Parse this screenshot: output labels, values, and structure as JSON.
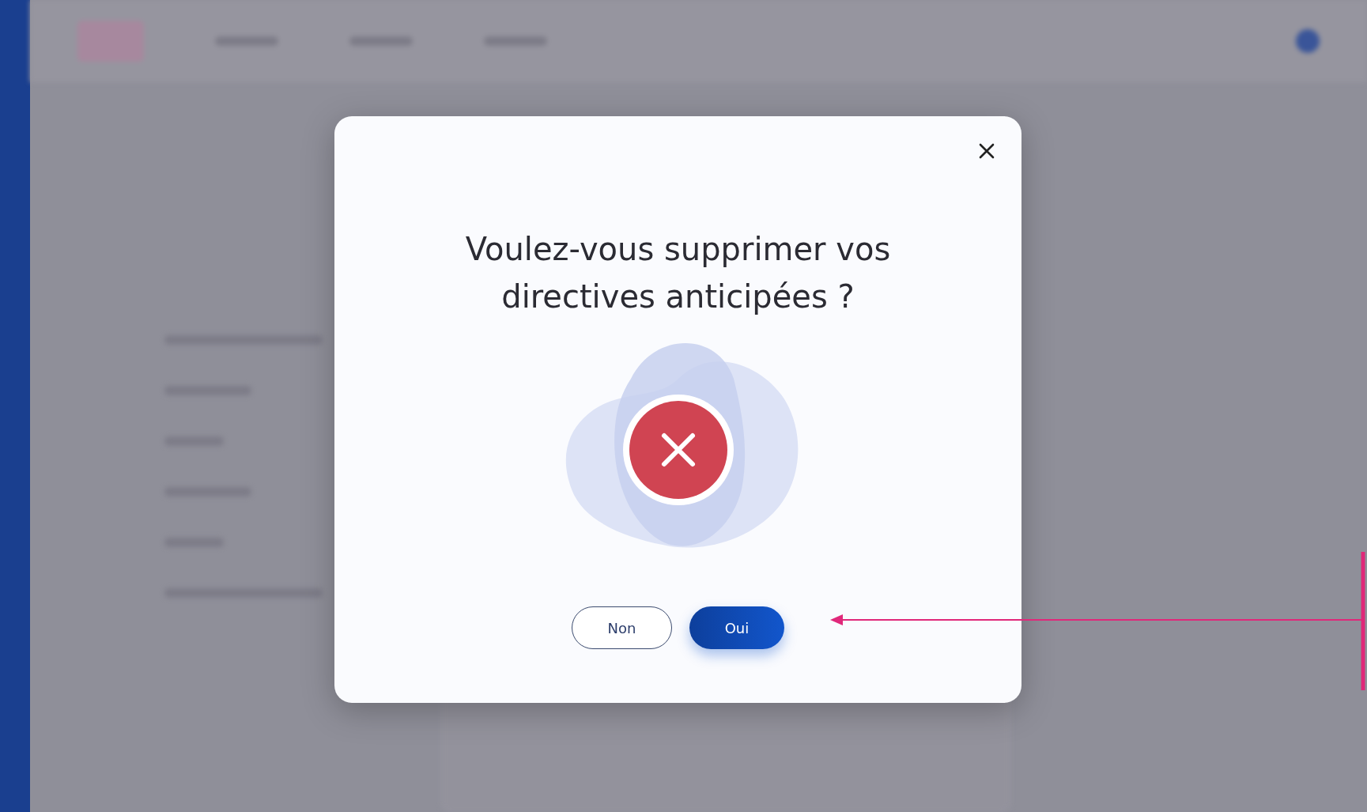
{
  "dialog": {
    "title": "Voulez-vous supprimer vos directives anticipées ?",
    "buttons": [
      {
        "label": "Non",
        "kind": "secondary"
      },
      {
        "label": "Oui",
        "kind": "primary"
      }
    ]
  }
}
